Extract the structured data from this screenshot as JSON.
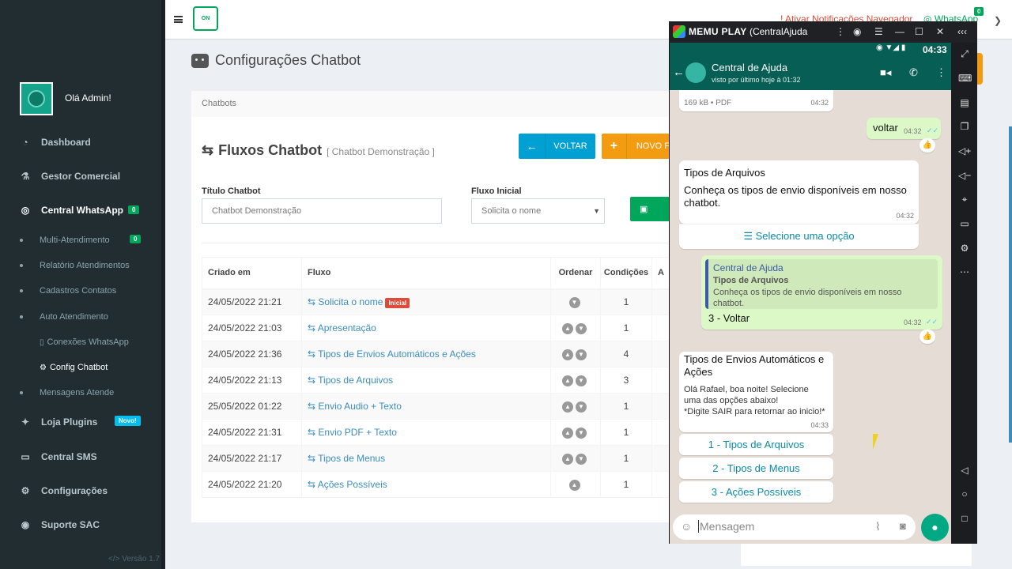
{
  "sidebar": {
    "greeting": "Olá Admin!",
    "items": [
      {
        "label": "Dashboard"
      },
      {
        "label": "Gestor Comercial"
      },
      {
        "label": "Central WhatsApp",
        "badge": "0"
      },
      {
        "label": "Loja Plugins",
        "badge": "Novo!"
      },
      {
        "label": "Central SMS"
      },
      {
        "label": "Configurações"
      },
      {
        "label": "Suporte SAC"
      }
    ],
    "subitems": [
      {
        "label": "Multi-Atendimento",
        "badge": "0"
      },
      {
        "label": "Relatório Atendimentos"
      },
      {
        "label": "Cadastros Contatos"
      },
      {
        "label": "Auto Atendimento"
      },
      {
        "label": "Conexões WhatsApp"
      },
      {
        "label": "Config Chatbot"
      },
      {
        "label": "Mensagens Atende"
      }
    ],
    "version": "Versão 1.7"
  },
  "header": {
    "logo_text": "ON",
    "notification": "Ativar Notificações Navegador",
    "whatsapp": "WhatsApp",
    "whatsapp_badge": "0"
  },
  "page": {
    "title": "Configurações Chatbot",
    "breadcrumb": "Chatbots",
    "box_title": "Fluxos Chatbot",
    "box_subtitle": "[ Chatbot Demonstração ]",
    "btn_back": "VOLTAR",
    "btn_new": "NOVO F",
    "field_title_label": "Título Chatbot",
    "field_title_value": "Chatbot Demonstração",
    "field_flow_label": "Fluxo Inicial",
    "field_flow_value": "Solicita o nome"
  },
  "table": {
    "headers": [
      "Criado em",
      "Fluxo",
      "Ordenar",
      "Condições",
      "A"
    ],
    "tag_initial": "Inicial",
    "rows": [
      {
        "date": "24/05/2022 21:21",
        "flow": "Solicita o nome",
        "conds": "1"
      },
      {
        "date": "24/05/2022 21:03",
        "flow": "Apresentação",
        "conds": "1"
      },
      {
        "date": "24/05/2022 21:36",
        "flow": "Tipos de Envios Automáticos e Ações",
        "conds": "4"
      },
      {
        "date": "24/05/2022 21:13",
        "flow": "Tipos de Arquivos",
        "conds": "3"
      },
      {
        "date": "25/05/2022 01:22",
        "flow": "Envio Audio + Texto",
        "conds": "1"
      },
      {
        "date": "24/05/2022 21:31",
        "flow": "Envio PDF + Texto",
        "conds": "1"
      },
      {
        "date": "24/05/2022 21:17",
        "flow": "Tipos de Menus",
        "conds": "1"
      },
      {
        "date": "24/05/2022 21:20",
        "flow": "Ações Possíveis",
        "conds": "1"
      }
    ]
  },
  "emulator": {
    "brand": "MEMU PLAY",
    "window": "(CentralAjuda"
  },
  "phone": {
    "time": "04:33",
    "contact": "Central de Ajuda",
    "last_seen": "visto por último hoje à 01:32",
    "messages": {
      "pdf_meta": "169 kB • PDF",
      "pdf_time": "04:32",
      "out1_text": "voltar",
      "out1_time": "04:32",
      "in1_title": "Tipos de Arquivos",
      "in1_body": "Conheça os tipos de envio disponíveis em nosso chatbot.",
      "in1_time": "04:32",
      "in1_action": "Selecione uma opção",
      "quote_author": "Central de Ajuda",
      "quote_title": "Tipos de Arquivos",
      "quote_body": "Conheça os tipos de envio disponíveis em nosso chatbot.",
      "out2_text": "3 - Voltar",
      "out2_time": "04:32",
      "in2_title": "Tipos de Envios Automáticos e Ações",
      "in2_body": "Olá Rafael, boa noite! Selecione uma das opções abaixo!\n*Digite SAIR para retornar ao inicio!*",
      "in2_time": "04:33",
      "options": [
        "1 - Tipos de Arquivos",
        "2 - Tipos de Menus",
        "3 - Ações Possíveis"
      ]
    },
    "input_placeholder": "Mensagem"
  }
}
